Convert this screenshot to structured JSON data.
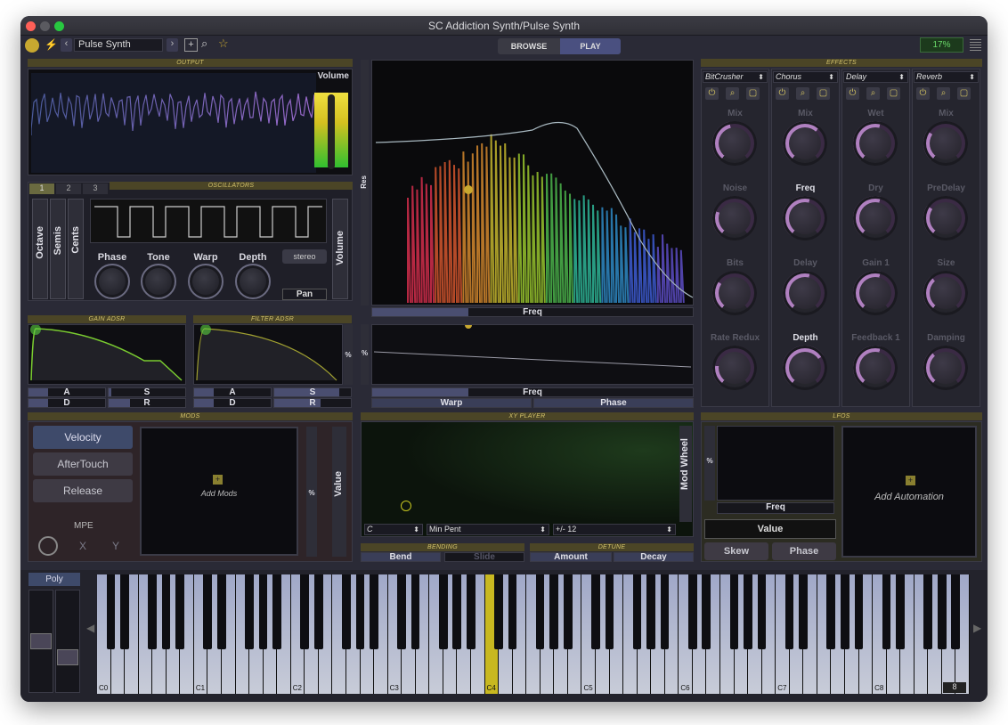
{
  "window": {
    "title": "SC Addiction Synth/Pulse Synth"
  },
  "toolbar": {
    "preset": "Pulse Synth",
    "prev": "‹",
    "next": "›",
    "browse": "BROWSE",
    "play": "PLAY",
    "cpu": "17%"
  },
  "sections": {
    "output": "OUTPUT",
    "oscillators": "OSCILLATORS",
    "gain_adsr": "GAIN ADSR",
    "filter_adsr": "FILTER ADSR",
    "mods": "MODS",
    "xy_player": "XY PLAYER",
    "bending": "BENDING",
    "detune": "DETUNE",
    "effects": "EFFECTS",
    "lfos": "LFOS"
  },
  "output": {
    "volume": "Volume"
  },
  "osc": {
    "tabs": [
      "1",
      "2",
      "3"
    ],
    "sliders": [
      "Octave",
      "Semis",
      "Cents"
    ],
    "knobs": [
      "Phase",
      "Tone",
      "Warp",
      "Depth"
    ],
    "stereo": "stereo",
    "pan": "Pan",
    "volume": "Volume"
  },
  "gain_adsr": {
    "a": "A",
    "s": "S",
    "d": "D",
    "r": "R"
  },
  "filter_adsr": {
    "a": "A",
    "s": "S",
    "d": "D",
    "r": "R",
    "pct": "%"
  },
  "filter": {
    "res": "Res",
    "freq": "Freq"
  },
  "lower": {
    "freq": "Freq",
    "warp": "Warp",
    "phase": "Phase",
    "pct": "%"
  },
  "effects": {
    "slots": [
      {
        "type": "BitCrusher",
        "knobs": [
          "Mix",
          "Noise",
          "Bits",
          "Rate Redux"
        ]
      },
      {
        "type": "Chorus",
        "knobs": [
          "Mix",
          "Freq",
          "Delay",
          "Depth"
        ]
      },
      {
        "type": "Delay",
        "knobs": [
          "Wet",
          "Dry",
          "Gain 1",
          "Feedback 1"
        ]
      },
      {
        "type": "Reverb",
        "knobs": [
          "Mix",
          "PreDelay",
          "Size",
          "Damping"
        ]
      }
    ]
  },
  "mods": {
    "velocity": "Velocity",
    "aftertouch": "AfterTouch",
    "release": "Release",
    "mpe": "MPE",
    "x": "X",
    "y": "Y",
    "add": "Add Mods",
    "pct": "%",
    "value": "Value"
  },
  "xy": {
    "key": "C",
    "scale": "Min Pent",
    "range": "+/- 12",
    "modwheel": "Mod Wheel"
  },
  "bend": {
    "bend": "Bend",
    "slide": "Slide",
    "amount": "Amount",
    "decay": "Decay"
  },
  "lfo": {
    "pct": "%",
    "freq": "Freq",
    "value": "Value",
    "skew": "Skew",
    "phase": "Phase",
    "add": "Add Automation"
  },
  "keyboard": {
    "poly": "Poly",
    "octaves": [
      "C0",
      "C1",
      "C2",
      "C3",
      "C4",
      "C5",
      "C6",
      "C7",
      "C8"
    ],
    "octave_value": "8"
  },
  "colors": {
    "accent": "#d4c36b",
    "highlight": "#c8b820",
    "panel": "#1c1c24"
  }
}
